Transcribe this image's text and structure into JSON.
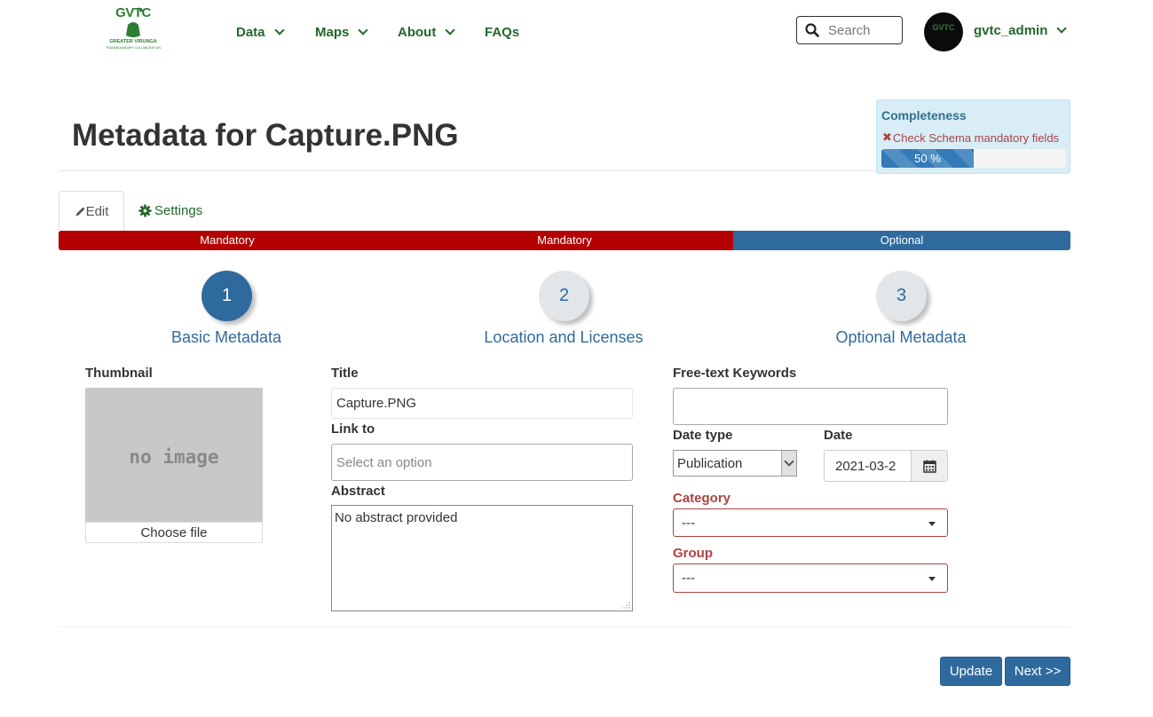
{
  "header": {
    "logo": {
      "text": "GVTC",
      "subtitle": "GREATER VIRUNGA",
      "tagline": "TRANSBOUNDARY COLLABORATION"
    },
    "nav": [
      {
        "label": "Data",
        "has_dropdown": true
      },
      {
        "label": "Maps",
        "has_dropdown": true
      },
      {
        "label": "About",
        "has_dropdown": true
      },
      {
        "label": "FAQs",
        "has_dropdown": false
      }
    ],
    "search": {
      "placeholder": "Search",
      "value": ""
    },
    "user": {
      "name": "gvtc_admin",
      "avatar_text": "GVTC"
    }
  },
  "page": {
    "title": "Metadata for Capture.PNG"
  },
  "completeness": {
    "title": "Completeness",
    "check_message": "Check Schema mandatory fields",
    "progress_label": "50 %",
    "progress_value": 50
  },
  "tabs": [
    {
      "label": "Edit",
      "icon": "pencil-icon",
      "active": true
    },
    {
      "label": "Settings",
      "icon": "gear-icon",
      "active": false
    }
  ],
  "stepbar": [
    "Mandatory",
    "Mandatory",
    "Optional"
  ],
  "steps": [
    {
      "number": "1",
      "label": "Basic Metadata",
      "active": true
    },
    {
      "number": "2",
      "label": "Location and Licenses",
      "active": false
    },
    {
      "number": "3",
      "label": "Optional Metadata",
      "active": false
    }
  ],
  "form": {
    "thumbnail": {
      "label": "Thumbnail",
      "placeholder_text": "no image",
      "choose_label": "Choose file"
    },
    "title": {
      "label": "Title",
      "value": "Capture.PNG"
    },
    "link_to": {
      "label": "Link to",
      "placeholder": "Select an option"
    },
    "abstract": {
      "label": "Abstract",
      "value": "No abstract provided"
    },
    "keywords": {
      "label": "Free-text Keywords",
      "value": ""
    },
    "date_type": {
      "label": "Date type",
      "value": "Publication"
    },
    "date": {
      "label": "Date",
      "value": "2021-03-2"
    },
    "category": {
      "label": "Category",
      "value": "---"
    },
    "group": {
      "label": "Group",
      "value": "---"
    }
  },
  "buttons": {
    "update": "Update",
    "next": "Next >>"
  },
  "colors": {
    "primary": "#2f6a9e",
    "mandatory": "#b30000",
    "nav_green": "#23672a",
    "error": "#a94442",
    "info_bg": "#d9edf7"
  }
}
